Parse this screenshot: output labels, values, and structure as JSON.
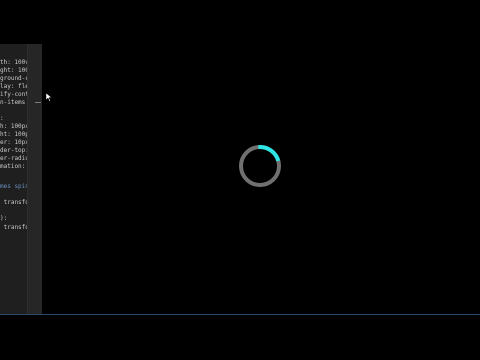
{
  "editor": {
    "lines": [
      "th: 100vw",
      "ght: 100",
      "ground-c",
      "lay: fle",
      "ify-cont",
      "n-items",
      "",
      ":",
      "h: 100px",
      "ht: 100p",
      "er: 10px",
      "der-top:",
      "er-radiu",
      "mation:",
      "",
      "mes spin",
      "",
      " transfo",
      "",
      "):",
      " transfo"
    ]
  },
  "colors": {
    "background": "#000000",
    "editor_bg": "#1f1f1f",
    "spinner_track": "#707070",
    "spinner_accent": "#2ee6e6"
  },
  "preview": {
    "spinner": {
      "accent_fraction": 0.22
    }
  }
}
